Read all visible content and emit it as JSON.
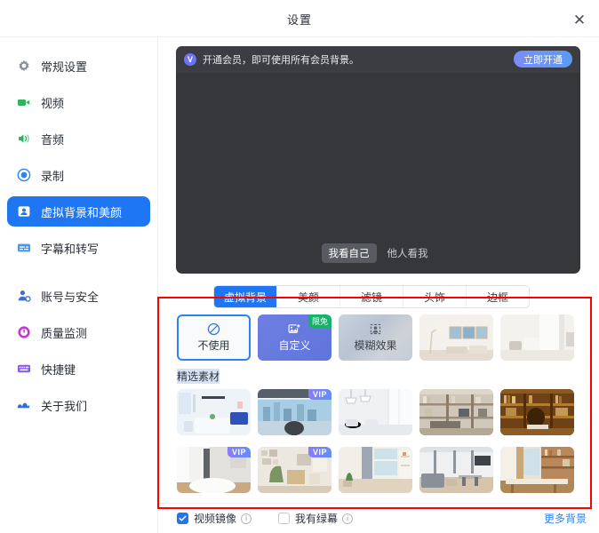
{
  "window": {
    "title": "设置",
    "close_label": "✕"
  },
  "sidebar": {
    "items": [
      {
        "label": "常规设置",
        "icon": "gear-icon",
        "active": false
      },
      {
        "label": "视频",
        "icon": "video-camera-icon",
        "active": false
      },
      {
        "label": "音频",
        "icon": "speaker-icon",
        "active": false
      },
      {
        "label": "录制",
        "icon": "record-icon",
        "active": false
      },
      {
        "label": "虚拟背景和美颜",
        "icon": "person-card-icon",
        "active": true
      },
      {
        "label": "字幕和转写",
        "icon": "subtitle-icon",
        "active": false
      },
      {
        "label": "账号与安全",
        "icon": "user-shield-icon",
        "active": false
      },
      {
        "label": "质量监测",
        "icon": "quality-monitor-icon",
        "active": false
      },
      {
        "label": "快捷键",
        "icon": "keyboard-icon",
        "active": false
      },
      {
        "label": "关于我们",
        "icon": "about-icon",
        "active": false
      }
    ]
  },
  "preview": {
    "banner_text": "开通会员，即可使用所有会员背景。",
    "banner_badge": "V",
    "cta_label": "立即开通",
    "view_self": "我看自己",
    "view_others": "他人看我"
  },
  "tabs": [
    {
      "label": "虚拟背景",
      "selected": true
    },
    {
      "label": "美颜",
      "selected": false
    },
    {
      "label": "滤镜",
      "selected": false
    },
    {
      "label": "头饰",
      "selected": false
    },
    {
      "label": "边框",
      "selected": false
    }
  ],
  "backgrounds": {
    "top_row": [
      {
        "type": "none",
        "label": "不使用",
        "selected": true,
        "badge": ""
      },
      {
        "type": "custom",
        "label": "自定义",
        "selected": false,
        "badge": "限免"
      },
      {
        "type": "blur",
        "label": "模糊效果",
        "selected": false,
        "badge": ""
      },
      {
        "type": "image",
        "label": "",
        "selected": false,
        "badge": "",
        "theme": "living-room-art"
      },
      {
        "type": "image",
        "label": "",
        "selected": false,
        "badge": "",
        "theme": "bedroom-curtain"
      }
    ],
    "section_title": "精选素材",
    "featured_row_1": [
      {
        "theme": "meeting-room-blue",
        "badge": ""
      },
      {
        "theme": "city-window-office",
        "badge": "VIP"
      },
      {
        "theme": "white-studio-lamps",
        "badge": ""
      },
      {
        "theme": "wooden-bookshelf",
        "badge": ""
      },
      {
        "theme": "classic-library",
        "badge": ""
      }
    ],
    "featured_row_2": [
      {
        "theme": "gray-conference",
        "badge": "VIP"
      },
      {
        "theme": "green-armchair-room",
        "badge": "VIP"
      },
      {
        "theme": "curtain-window-plant",
        "badge": ""
      },
      {
        "theme": "modern-loft-lounge",
        "badge": ""
      },
      {
        "theme": "long-table-shelves",
        "badge": ""
      }
    ]
  },
  "bottom": {
    "mirror_label": "视频镜像",
    "mirror_checked": true,
    "greenscreen_label": "我有绿幕",
    "greenscreen_checked": false,
    "info_glyph": "i",
    "more_backgrounds": "更多背景"
  },
  "colors": {
    "accent": "#1f76f2",
    "annotation": "#fe0000",
    "vip_badge": "#8b7bf8",
    "free_badge": "#17b26a"
  }
}
